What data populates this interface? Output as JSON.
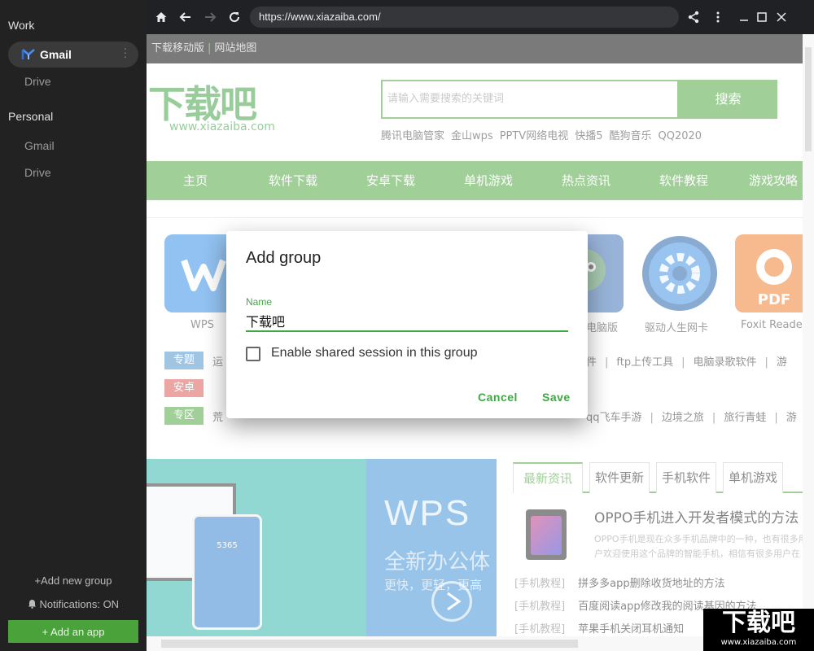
{
  "sidebar": {
    "groups": [
      {
        "title": "Work",
        "apps": [
          {
            "label": "Gmail"
          },
          {
            "label": "Drive"
          }
        ]
      },
      {
        "title": "Personal",
        "apps": [
          {
            "label": "Gmail"
          },
          {
            "label": "Drive"
          }
        ]
      }
    ],
    "add_group": "+Add new group",
    "notifications": "Notifications: ON",
    "add_app": "+ Add an app"
  },
  "toolbar": {
    "url": "https://www.xiazaiba.com/"
  },
  "web": {
    "topbar": {
      "left": "下载移动版",
      "sep": "|",
      "right": "网站地图"
    },
    "logo": {
      "text": "下载吧",
      "domain": "www.xiazaiba.com"
    },
    "search": {
      "placeholder": "请输入需要搜索的关键词",
      "button": "搜索"
    },
    "hotwords": [
      "腾讯电脑管家",
      "金山wps",
      "PPTV网络电视",
      "快播5",
      "酷狗音乐",
      "QQ2020"
    ],
    "nav": [
      "主页",
      "软件下载",
      "安卓下载",
      "单机游戏",
      "热点资讯",
      "软件教程",
      "游戏攻略"
    ],
    "apps": [
      {
        "label": "WPS"
      },
      {
        "label": "电脑版"
      },
      {
        "label": "驱动人生网卡"
      },
      {
        "label": "Foxit Reade"
      }
    ],
    "tags": [
      {
        "label": "专题",
        "color": "#4a90c8"
      },
      {
        "label": "安卓",
        "color": "#d9534f"
      },
      {
        "label": "专区",
        "color": "#4aa33a"
      }
    ],
    "topic_links": {
      "first": "运",
      "rest": [
        "件",
        "ftp上传工具",
        "电脑录歌软件",
        "游"
      ]
    },
    "zone_links": {
      "first": "荒",
      "rest": [
        "qq飞车手游",
        "边境之旅",
        "旅行青蛙",
        "游"
      ]
    },
    "banner": {
      "brand": "WPS",
      "headline": "全新办公体",
      "sub": "更快，更轻，更高",
      "phone_num": "5365"
    },
    "news_tabs": [
      "最新资讯",
      "软件更新",
      "手机软件",
      "单机游戏"
    ],
    "featured": {
      "title": "OPPO手机进入开发者模式的方法",
      "summary": "OPPO手机是现在众多手机品牌中的一种，也有很多用户欢迎使用这个品牌的智能手机，相信有很多用户在"
    },
    "news": [
      {
        "cat": "[手机教程]",
        "title": "拼多多app删除收货地址的方法"
      },
      {
        "cat": "[手机教程]",
        "title": "百度阅读app修改我的阅读基因的方法"
      },
      {
        "cat": "[手机教程]",
        "title": "苹果手机关闭耳机通知"
      }
    ],
    "watermark": {
      "main": "下载吧",
      "url": "www.xiazaiba.com"
    }
  },
  "dialog": {
    "title": "Add group",
    "name_label": "Name",
    "name_value": "下载吧",
    "checkbox_label": "Enable shared session in this group",
    "checkbox_checked": false,
    "cancel": "Cancel",
    "save": "Save"
  },
  "colors": {
    "accent": "#3fa843",
    "site_green": "#4aa33a",
    "sidebar_bg": "#222222",
    "chrome_bg": "#202124"
  }
}
